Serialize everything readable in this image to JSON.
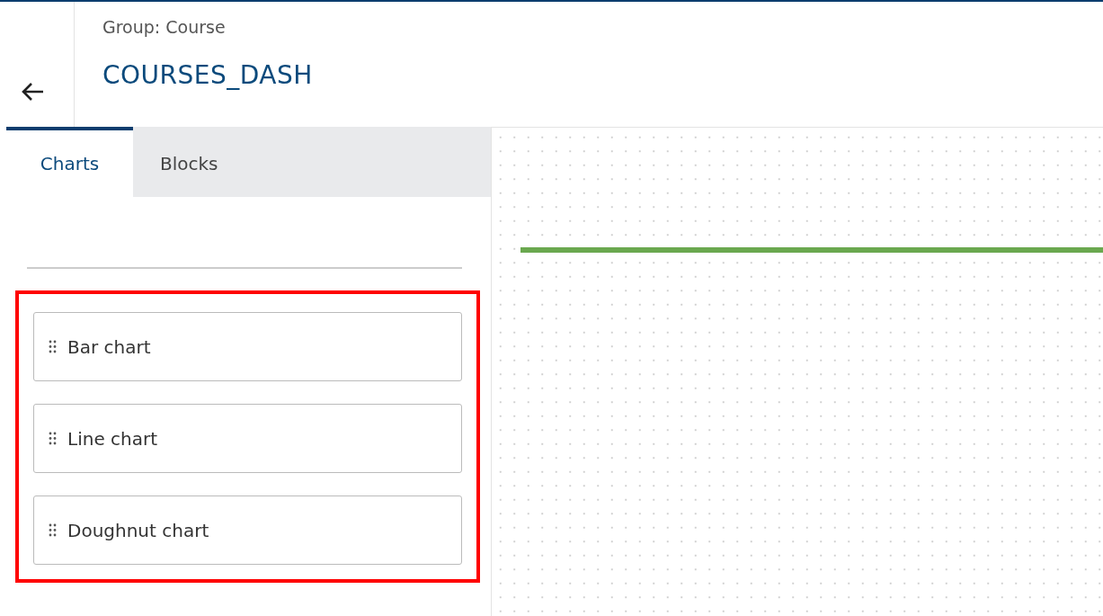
{
  "header": {
    "group_label": "Group: Course",
    "title": "COURSES_DASH"
  },
  "tabs": [
    {
      "label": "Charts",
      "selected": true
    },
    {
      "label": "Blocks",
      "selected": false
    }
  ],
  "palette": {
    "highlighted": true,
    "items": [
      {
        "label": "Bar chart"
      },
      {
        "label": "Line chart"
      },
      {
        "label": "Doughnut chart"
      }
    ]
  }
}
